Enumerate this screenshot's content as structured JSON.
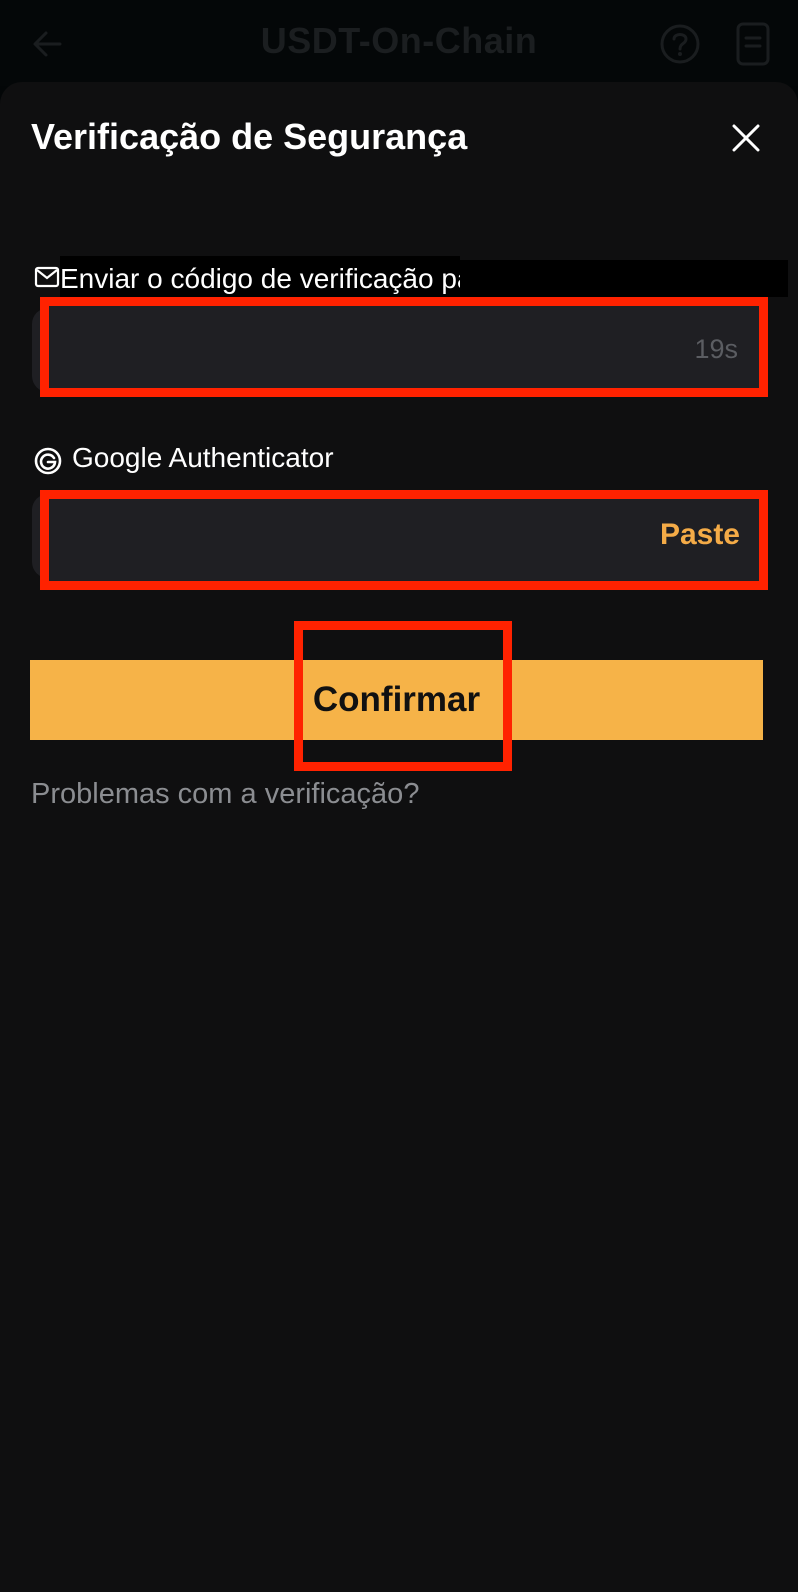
{
  "appbar": {
    "title": "USDT-On-Chain",
    "icons": [
      "back-arrow-icon",
      "help-icon",
      "document-icon"
    ]
  },
  "sheet": {
    "title": "Verificação de Segurança",
    "close_icon": "close-icon"
  },
  "email_section": {
    "label": "Enviar o código de verificação para",
    "icon": "mail-icon",
    "input_value": "",
    "resend_timer": "19s"
  },
  "ga_section": {
    "label": "Google Authenticator",
    "icon": "google-authenticator-icon",
    "input_value": "",
    "paste_label": "Paste"
  },
  "actions": {
    "confirm_label": "Confirmar",
    "problems_link": "Problemas com a verificação?"
  },
  "colors": {
    "accent": "#f6b348",
    "paste": "#f4ab47",
    "highlight": "#ff2200",
    "sheet_bg": "#0f0f10",
    "field_bg": "#1f1f23"
  }
}
